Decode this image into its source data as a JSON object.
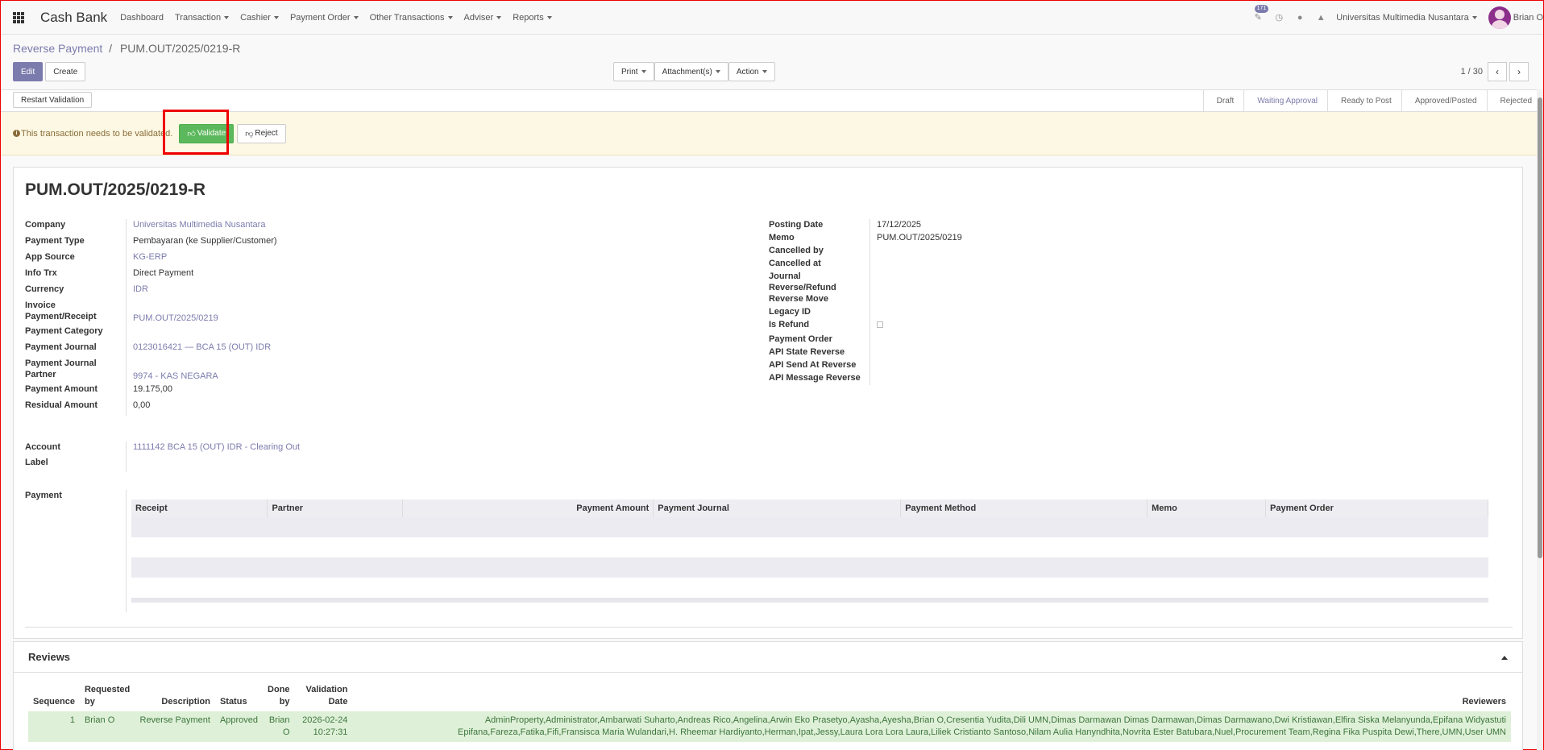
{
  "app": {
    "brand": "Cash Bank",
    "menu": [
      {
        "label": "Dashboard",
        "has_caret": false
      },
      {
        "label": "Transaction",
        "has_caret": true
      },
      {
        "label": "Cashier",
        "has_caret": true
      },
      {
        "label": "Payment Order",
        "has_caret": true
      },
      {
        "label": "Other Transactions",
        "has_caret": true
      },
      {
        "label": "Adviser",
        "has_caret": true
      },
      {
        "label": "Reports",
        "has_caret": true
      }
    ],
    "activity_badge": "171",
    "company": "Universitas Multimedia Nusantara",
    "user": "Brian O"
  },
  "breadcrumb": {
    "parent": "Reverse Payment",
    "separator": "/",
    "current": "PUM.OUT/2025/0219-R"
  },
  "control_panel": {
    "edit": "Edit",
    "create": "Create",
    "print": "Print",
    "attachments": "Attachment(s)",
    "action": "Action",
    "pager": "1 / 30"
  },
  "status": {
    "restart": "Restart Validation",
    "stages": [
      "Draft",
      "Waiting Approval",
      "Ready to Post",
      "Approved/Posted",
      "Rejected"
    ],
    "active_stage": "Waiting Approval"
  },
  "alert": {
    "text": "This transaction needs to be validated.",
    "validate": "Validate",
    "reject": "Reject"
  },
  "record": {
    "title": "PUM.OUT/2025/0219-R",
    "left_fields": [
      {
        "label": "Company",
        "value": "Universitas Multimedia Nusantara",
        "link": true
      },
      {
        "label": "Payment Type",
        "value": "Pembayaran (ke Supplier/Customer)",
        "link": false
      },
      {
        "label": "App Source",
        "value": "KG-ERP",
        "link": true
      },
      {
        "label": "Info Trx",
        "value": "Direct Payment",
        "link": false
      },
      {
        "label": "Currency",
        "value": "IDR",
        "link": true
      },
      {
        "label": "Invoice Payment/Receipt",
        "value": "PUM.OUT/2025/0219",
        "link": true
      },
      {
        "label": "Payment Category",
        "value": "",
        "link": false
      },
      {
        "label": "Payment Journal",
        "value": "0123016421 — BCA 15 (OUT) IDR",
        "link": true
      },
      {
        "label": "Payment Journal Partner",
        "value": "9974 - KAS NEGARA",
        "link": true
      },
      {
        "label": "Payment Amount",
        "value": "19.175,00",
        "link": false
      },
      {
        "label": "Residual Amount",
        "value": "0,00",
        "link": false
      }
    ],
    "right_fields": [
      {
        "label": "Posting Date",
        "value": "17/12/2025"
      },
      {
        "label": "Memo",
        "value": "PUM.OUT/2025/0219"
      },
      {
        "label": "Cancelled by",
        "value": ""
      },
      {
        "label": "Cancelled at",
        "value": ""
      },
      {
        "label": "Journal Reverse/Refund",
        "value": ""
      },
      {
        "label": "Reverse Move",
        "value": ""
      },
      {
        "label": "Legacy ID",
        "value": ""
      },
      {
        "label": "Is Refund",
        "value": ""
      },
      {
        "label": "Payment Order",
        "value": ""
      },
      {
        "label": "API State Reverse",
        "value": ""
      },
      {
        "label": "API Send At Reverse",
        "value": ""
      },
      {
        "label": "API Message Reverse",
        "value": ""
      }
    ],
    "account_label": "Account",
    "account_value": "1111142 BCA 15 (OUT) IDR - Clearing Out",
    "label_label": "Label",
    "payment_label": "Payment",
    "payment_columns": [
      "Receipt",
      "Partner",
      "Payment Amount",
      "Payment Journal",
      "Payment Method",
      "Memo",
      "Payment Order"
    ]
  },
  "reviews": {
    "title": "Reviews",
    "columns": [
      "Sequence",
      "Requested by",
      "Description",
      "Status",
      "Done by",
      "Validation Date",
      "Reviewers"
    ],
    "rows": [
      {
        "sequence": "1",
        "requested_by": "Brian O",
        "description": "Reverse Payment",
        "status": "Approved",
        "done_by": "Brian O",
        "validation_date": "2026-02-24 10:27:31",
        "reviewers": "AdminProperty,Administrator,Ambarwati Suharto,Andreas Rico,Angelina,Arwin Eko Prasetyo,Ayasha,Ayesha,Brian O,Cresentia Yudita,Dili UMN,Dimas Darmawan Dimas Darmawan,Dimas Darmawano,Dwi Kristiawan,Elfira Siska Melanyunda,Epifana Widyastuti Epifana,Fareza,Fatika,Fifi,Fransisca Maria Wulandari,H. Rheemar Hardiyanto,Herman,Ipat,Jessy,Laura Lora Lora Laura,Liliek Cristianto Santoso,Nilam Aulia Hanyndhita,Novrita Ester Batubara,Nuel,Procurement Team,Regina Fika Puspita Dewi,There,UMN,User UMN"
      }
    ]
  }
}
